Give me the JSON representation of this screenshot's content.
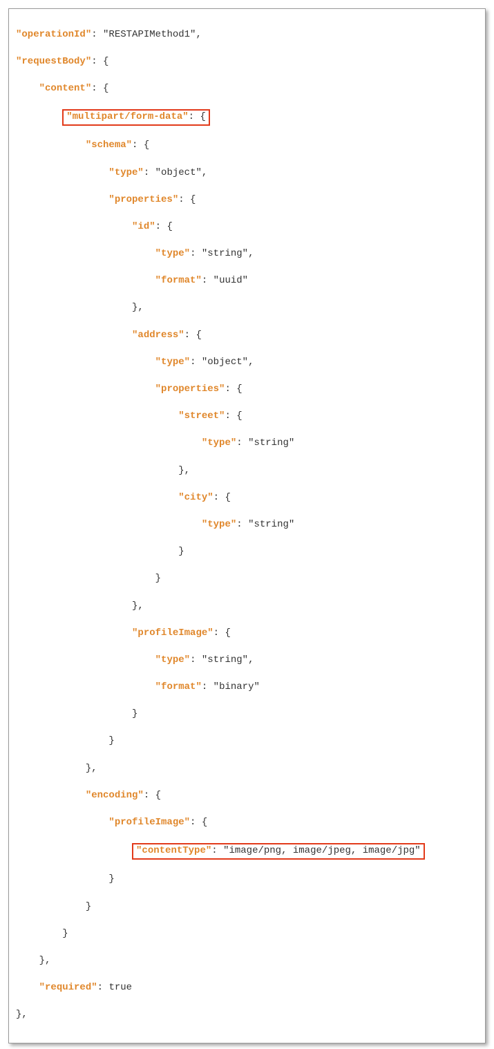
{
  "code": {
    "l1_key": "\"operationId\"",
    "l1_val": "\"RESTAPIMethod1\"",
    "l2_key": "\"requestBody\"",
    "l3_key": "\"content\"",
    "l4_highlight_key": "\"multipart/form-data\"",
    "l5_key": "\"schema\"",
    "l6_key": "\"type\"",
    "l6_val": "\"object\"",
    "l7_key": "\"properties\"",
    "l8_key": "\"id\"",
    "l9_key": "\"type\"",
    "l9_val": "\"string\"",
    "l10_key": "\"format\"",
    "l10_val": "\"uuid\"",
    "l12_key": "\"address\"",
    "l13_key": "\"type\"",
    "l13_val": "\"object\"",
    "l14_key": "\"properties\"",
    "l15_key": "\"street\"",
    "l16_key": "\"type\"",
    "l16_val": "\"string\"",
    "l18_key": "\"city\"",
    "l19_key": "\"type\"",
    "l19_val": "\"string\"",
    "l23_key": "\"profileImage\"",
    "l24_key": "\"type\"",
    "l24_val": "\"string\"",
    "l25_key": "\"format\"",
    "l25_val": "\"binary\"",
    "l29_key": "\"encoding\"",
    "l30_key": "\"profileImage\"",
    "l31_highlight_key": "\"contentType\"",
    "l31_highlight_val": "\"image/png, image/jpeg, image/jpg\"",
    "l36_key": "\"required\"",
    "l36_val": "true"
  }
}
